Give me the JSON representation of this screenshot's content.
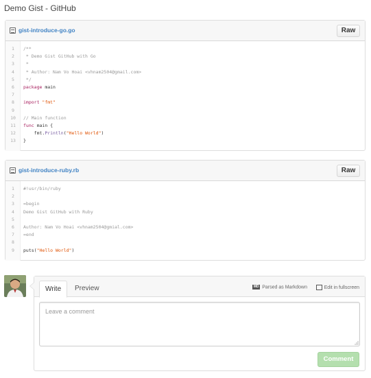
{
  "page": {
    "title": "Demo Gist - GitHub"
  },
  "files": [
    {
      "name": "gist-introduce-go.go",
      "raw_label": "Raw",
      "lines": [
        {
          "n": "1",
          "html": "<span class=\"c\">/**</span>"
        },
        {
          "n": "2",
          "html": "<span class=\"c\"> * Demo Gist GitHub with Go</span>"
        },
        {
          "n": "3",
          "html": "<span class=\"c\"> *</span>"
        },
        {
          "n": "4",
          "html": "<span class=\"c\"> * Author: Nam Vo Hoai &lt;vhnam2504@gmail.com&gt;</span>"
        },
        {
          "n": "5",
          "html": "<span class=\"c\"> */</span>"
        },
        {
          "n": "6",
          "html": "<span class=\"k\">package</span> main"
        },
        {
          "n": "7",
          "html": ""
        },
        {
          "n": "8",
          "html": "<span class=\"k\">import</span> <span class=\"s\">\"fmt\"</span>"
        },
        {
          "n": "9",
          "html": ""
        },
        {
          "n": "10",
          "html": "<span class=\"c\">// Main function</span>"
        },
        {
          "n": "11",
          "html": "<span class=\"k\">func</span> main {"
        },
        {
          "n": "12",
          "html": "    fmt.<span class=\"f\">Println</span>(<span class=\"s\">\"Hello World\"</span>)"
        },
        {
          "n": "13",
          "html": "}"
        }
      ]
    },
    {
      "name": "gist-introduce-ruby.rb",
      "raw_label": "Raw",
      "lines": [
        {
          "n": "1",
          "html": "<span class=\"c\">#!usr/bin/ruby</span>"
        },
        {
          "n": "2",
          "html": ""
        },
        {
          "n": "3",
          "html": "<span class=\"c\">=begin</span>"
        },
        {
          "n": "4",
          "html": "<span class=\"c\">Demo Gist GitHub with Ruby</span>"
        },
        {
          "n": "5",
          "html": ""
        },
        {
          "n": "6",
          "html": "<span class=\"c\">Author: Nam Vo Hoai &lt;vhnam2504@gmial.com&gt;</span>"
        },
        {
          "n": "7",
          "html": "<span class=\"c\">=end</span>"
        },
        {
          "n": "8",
          "html": ""
        },
        {
          "n": "9",
          "html": "puts(<span class=\"s\">\"Hello World\"</span>)"
        }
      ]
    }
  ],
  "comment": {
    "tabs": {
      "write": "Write",
      "preview": "Preview"
    },
    "tools": {
      "markdown_badge": "MD",
      "markdown": "Parsed as Markdown",
      "fullscreen": "Edit in fullscreen"
    },
    "placeholder": "Leave a comment",
    "submit": "Comment"
  },
  "colors": {
    "link": "#4183c4",
    "keyword": "#a71d5d",
    "string": "#df5000",
    "func": "#795da3",
    "comment": "#999999",
    "submit_disabled": "#b4dfae"
  }
}
